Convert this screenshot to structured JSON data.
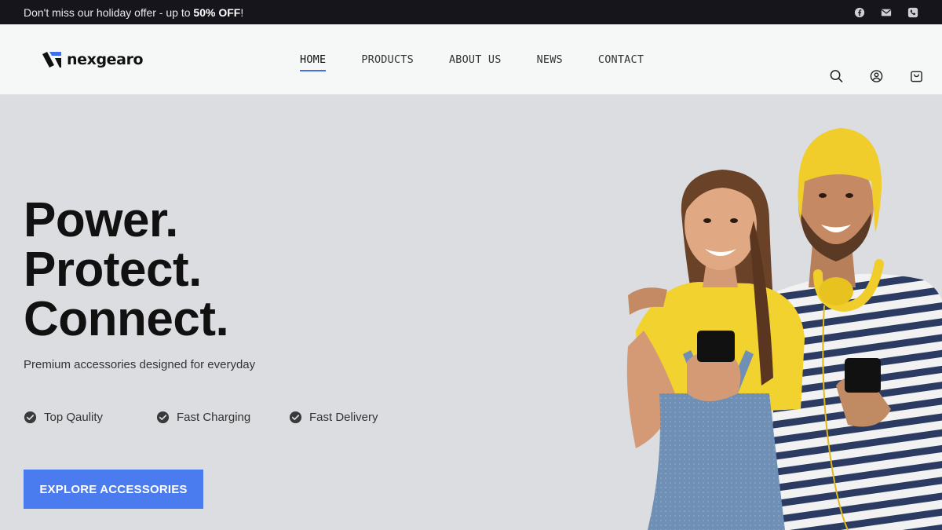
{
  "topbar": {
    "promo_text": "Don't miss our holiday offer - up to ",
    "promo_highlight": "50% OFF",
    "promo_end": "!",
    "social_icons": [
      "facebook-icon",
      "mail-icon",
      "phone-icon"
    ]
  },
  "header": {
    "logo_text": "nexgearo",
    "nav": [
      {
        "label": "HOME",
        "active": true
      },
      {
        "label": "PRODUCTS",
        "active": false
      },
      {
        "label": "ABOUT US",
        "active": false
      },
      {
        "label": "NEWS",
        "active": false
      },
      {
        "label": "CONTACT",
        "active": false
      }
    ],
    "icons": [
      "search-icon",
      "account-icon",
      "cart-icon"
    ]
  },
  "hero": {
    "headline": [
      "Power.",
      "Protect.",
      "Connect."
    ],
    "subtitle": "Premium accessories designed for everyday",
    "features": [
      "Top Qaulity",
      "Fast Charging",
      "Fast Delivery"
    ],
    "cta_label": "EXPLORE ACCESSORIES"
  },
  "colors": {
    "topbar_bg": "#16151c",
    "accent": "#4a7bef",
    "hero_bg": "#dcdde0"
  }
}
